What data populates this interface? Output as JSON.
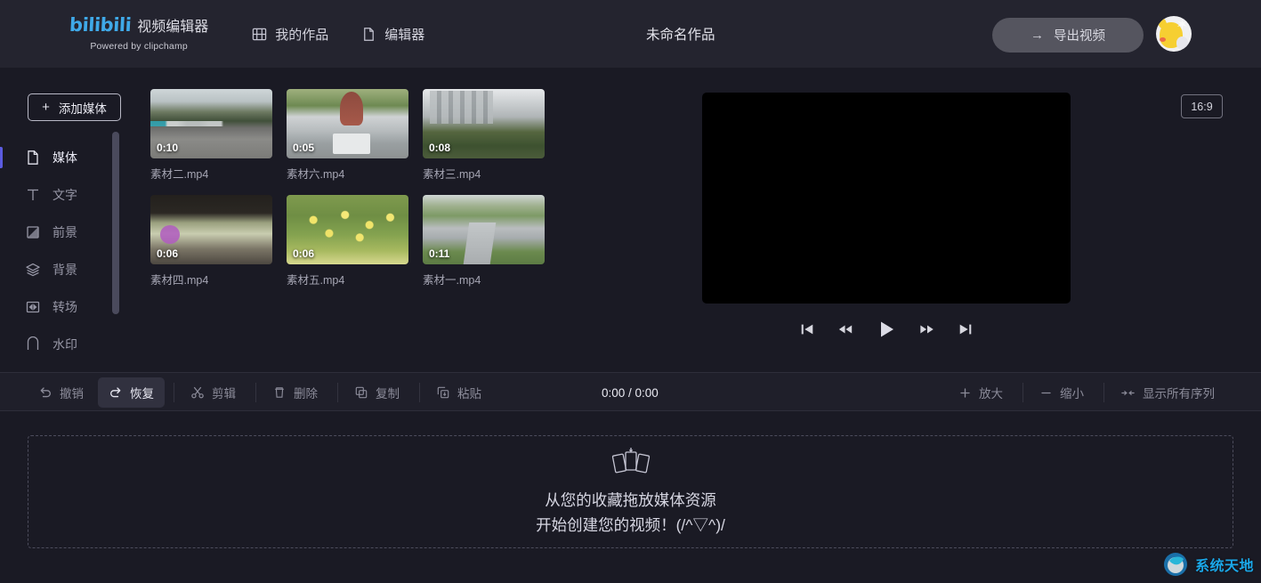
{
  "header": {
    "logo_text": "bilibili",
    "logo_zh": "视频编辑器",
    "powered_by": "Powered by clipchamp",
    "nav": [
      {
        "label": "我的作品",
        "icon": "film-strip-icon"
      },
      {
        "label": "编辑器",
        "icon": "document-icon"
      }
    ],
    "document_title": "未命名作品",
    "export_arrow": "→",
    "export_label": "导出视频",
    "avatar": "user-avatar"
  },
  "rail": {
    "add_media_plus": "+",
    "add_media_label": "添加媒体",
    "items": [
      {
        "label": "媒体",
        "icon": "document-icon",
        "active": true
      },
      {
        "label": "文字",
        "icon": "text-T-icon",
        "active": false
      },
      {
        "label": "前景",
        "icon": "foreground-square-icon",
        "active": false
      },
      {
        "label": "背景",
        "icon": "layers-icon",
        "active": false
      },
      {
        "label": "转场",
        "icon": "transition-icon",
        "active": false
      },
      {
        "label": "水印",
        "icon": "watermark-icon",
        "active": false
      }
    ]
  },
  "media": {
    "rows": [
      [
        {
          "name": "素材二.mp4",
          "duration": "0:10",
          "art": "t1"
        },
        {
          "name": "素材六.mp4",
          "duration": "0:05",
          "art": "t2"
        },
        {
          "name": "素材三.mp4",
          "duration": "0:08",
          "art": "t3"
        }
      ],
      [
        {
          "name": "素材四.mp4",
          "duration": "0:06",
          "art": "t4"
        },
        {
          "name": "素材五.mp4",
          "duration": "0:06",
          "art": "t5"
        },
        {
          "name": "素材一.mp4",
          "duration": "0:11",
          "art": "t6"
        }
      ]
    ]
  },
  "preview": {
    "aspect_ratio": "16:9",
    "controls": [
      {
        "name": "skip-to-start-icon"
      },
      {
        "name": "rewind-icon"
      },
      {
        "name": "play-icon"
      },
      {
        "name": "fast-forward-icon"
      },
      {
        "name": "skip-to-end-icon"
      }
    ]
  },
  "toolbar": {
    "left": [
      {
        "label": "撤销",
        "icon": "undo-icon",
        "active": false
      },
      {
        "label": "恢复",
        "icon": "redo-icon",
        "active": true
      },
      {
        "label": "剪辑",
        "icon": "scissors-icon",
        "active": false
      },
      {
        "label": "删除",
        "icon": "trash-icon",
        "active": false
      },
      {
        "label": "复制",
        "icon": "copy-icon",
        "active": false
      },
      {
        "label": "粘贴",
        "icon": "paste-icon",
        "active": false
      }
    ],
    "time_code": "0:00 / 0:00",
    "right": [
      {
        "label": "放大",
        "icon": "zoom-in-icon"
      },
      {
        "label": "缩小",
        "icon": "zoom-out-icon"
      },
      {
        "label": "显示所有序列",
        "icon": "fit-to-screen-icon"
      }
    ]
  },
  "timeline": {
    "empty_line1": "从您的收藏拖放媒体资源",
    "empty_line2": "开始创建您的视频！(/^▽^)/"
  },
  "watermark": {
    "text": "系统天地"
  },
  "colors": {
    "accent_blue": "#3fa9e8",
    "active_indicator": "#5b5be0",
    "header_bg": "#24242f",
    "body_bg": "#1a1a24",
    "toolbar_bg": "#1f1f2a",
    "watermark_blue": "#1ba7e8"
  }
}
